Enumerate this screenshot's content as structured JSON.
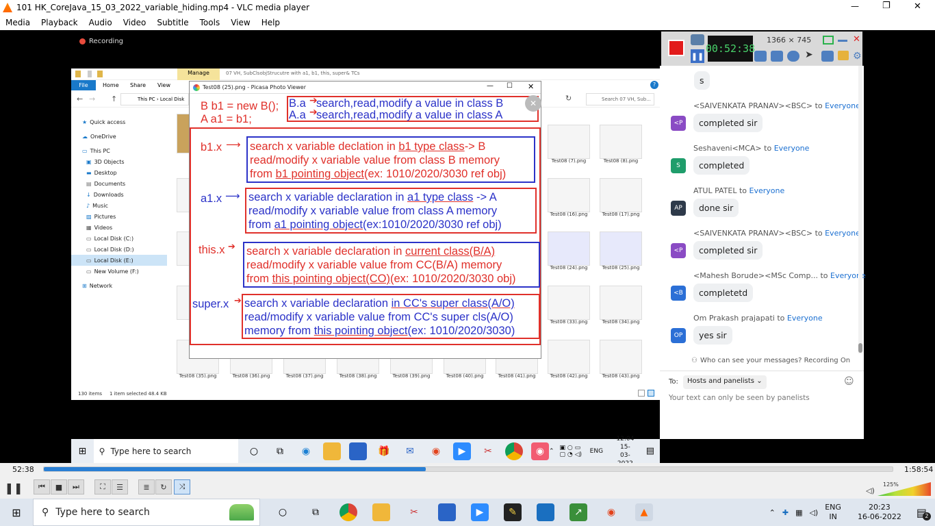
{
  "window": {
    "title": "101 HK_CoreJava_15_03_2022_variable_hiding.mp4 - VLC media player",
    "minimize": "—",
    "restore": "❐",
    "close": "✕"
  },
  "menu": [
    "Media",
    "Playback",
    "Audio",
    "Video",
    "Subtitle",
    "Tools",
    "View",
    "Help"
  ],
  "recording": {
    "label": "Recording"
  },
  "recorder": {
    "time": "00:52:38",
    "resolution": "1366 × 745"
  },
  "explorer": {
    "ribbon_tabs": [
      "File",
      "Home",
      "Share",
      "View"
    ],
    "manage_tab": "Manage",
    "window_title": "07 VH, SubClsobjStrucutre with a1, b1, this, super& TCs",
    "path": "This PC  ›  Local Disk",
    "search": "Search 07 VH, Sub...",
    "nav": [
      "Quick access",
      "OneDrive",
      "This PC",
      "3D Objects",
      "Desktop",
      "Documents",
      "Downloads",
      "Music",
      "Pictures",
      "Videos",
      "Local Disk (C:)",
      "Local Disk (D:)",
      "Local Disk (E:)",
      "New Volume (F:)",
      "Network"
    ],
    "status_items": "130 items",
    "status_selected": "1 item selected  48.4 KB",
    "right_thumbs": [
      {
        "label": "Test08 (7).png"
      },
      {
        "label": "Test08 (8).png"
      },
      {
        "label": "Test08 (16).png"
      },
      {
        "label": "Test08 (17).png"
      },
      {
        "label": "Test08 (24).png"
      },
      {
        "label": "Test08 (25).png"
      },
      {
        "label": "Test08 (33).png"
      },
      {
        "label": "Test08 (34).png"
      },
      {
        "label": "Test08 (42).png"
      },
      {
        "label": "Test08 (43).png"
      }
    ],
    "bottom_thumbs": [
      "Test08 (35).png",
      "Test08 (36).png",
      "Test08 (37).png",
      "Test08 (38).png",
      "Test08 (39).png",
      "Test08 (40).png",
      "Test08 (41).png"
    ]
  },
  "picasa": {
    "title": "Test08 (25).png - Picasa Photo Viewer",
    "line1_left": "B b1 = new B();",
    "line2_left": "A a1 = b1;",
    "top_box": [
      "B.a",
      "search,read,modify a  value in class B",
      "A.a",
      "search,read,modify a  value in class A"
    ],
    "sections": [
      {
        "label": "b1.x",
        "l1a": "search x variable declation in ",
        "l1u": "b1 type class",
        "l1b": "-> B",
        "l2": "read/modify x variable value from class B memory",
        "l3a": "from ",
        "l3u": "b1 pointing object",
        "l3b": "(ex: 1010/2020/3030 ref obj)"
      },
      {
        "label": "a1.x",
        "l1a": "search x variable declaration in ",
        "l1u": "a1 type class",
        "l1b": " -> A",
        "l2": "read/modify x variable value from class A memory",
        "l3a": "from ",
        "l3u": "a1 pointing object",
        "l3b": "(ex:1010/2020/3030 ref obj)"
      },
      {
        "label": "this.x",
        "l1a": "search x variable declaration in ",
        "l1u": "current class(B/A)",
        "l1b": "",
        "l2": "read/modify x variable value from CC(B/A) memory",
        "l3a": "from ",
        "l3u": "this pointing object(CO)",
        "l3b": "(ex: 1010/2020/3030 obj)"
      },
      {
        "label": "super.x",
        "l1a": "search x variable declaration ",
        "l1u": "in CC's super class(A/O)",
        "l1b": "",
        "l2": "read/modify x variable value from CC's super cls(A/O)",
        "l3a": "memory from ",
        "l3u": "this pointing object",
        "l3b": "(ex: 1010/2020/3030)"
      }
    ]
  },
  "chat": {
    "first_bubble": "s",
    "messages": [
      {
        "sender": "<SAIVENKATA PRANAV><BSC>",
        "to": "Everyone",
        "avatar": "<P",
        "color": "#8a4bc4",
        "text": "completed sir"
      },
      {
        "sender": "Seshaveni<MCA>",
        "to": "Everyone",
        "avatar": "S",
        "color": "#1f9d6b",
        "text": "completed"
      },
      {
        "sender": "ATUL PATEL",
        "to": "Everyone",
        "avatar": "AP",
        "color": "#2e3a4a",
        "text": "done sir"
      },
      {
        "sender": "<SAIVENKATA PRANAV><BSC>",
        "to": "Everyone",
        "avatar": "<P",
        "color": "#8a4bc4",
        "text": "completed sir"
      },
      {
        "sender": "<Mahesh Borude><MSc Comp...",
        "to": "Everyone",
        "avatar": "<B",
        "color": "#2b6fd6",
        "text": "completetd"
      },
      {
        "sender": "Om Prakash prajapati",
        "to": "Everyone",
        "avatar": "OP",
        "color": "#2b6fd6",
        "text": "yes sir"
      }
    ],
    "to_word": "to",
    "privacy": "Who can see your messages? Recording On",
    "to_label": "To:",
    "to_select": "Hosts and panelists ⌄",
    "placeholder": "Your text can only be seen by panelists"
  },
  "inner_taskbar": {
    "search": "Type here to search",
    "lang": "ENG",
    "time": "12:04",
    "date": "15-03-2022"
  },
  "player": {
    "elapsed": "52:38",
    "total": "1:58:54",
    "progress": 0.45,
    "volume": "125%"
  },
  "taskbar": {
    "search": "Type here to search",
    "lang1": "ENG",
    "lang2": "IN",
    "time": "20:23",
    "date": "16-06-2022",
    "notif": "2"
  }
}
